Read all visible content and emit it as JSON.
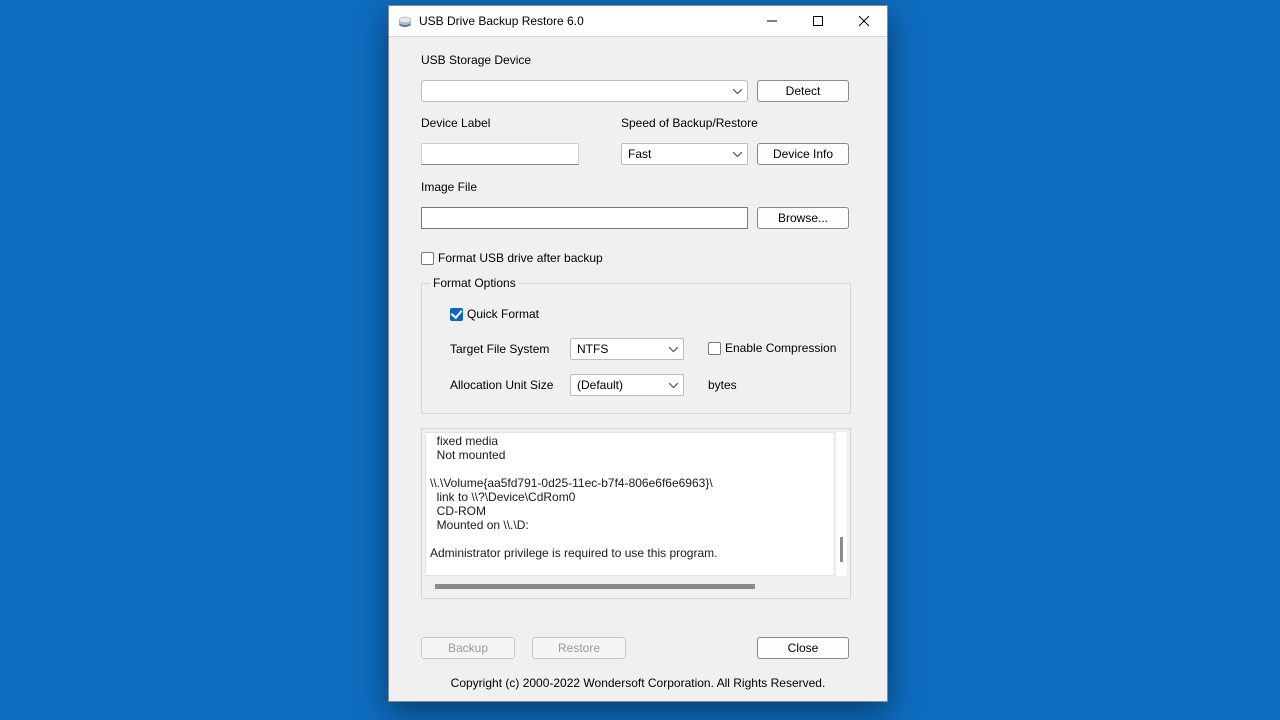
{
  "window": {
    "title": "USB Drive Backup Restore 6.0"
  },
  "labels": {
    "usb_storage_device": "USB Storage Device",
    "device_label": "Device Label",
    "speed": "Speed of Backup/Restore",
    "image_file": "Image File",
    "format_after_backup": "Format USB drive after backup",
    "format_options": "Format Options",
    "quick_format": "Quick Format",
    "target_fs": "Target File System",
    "enable_compression": "Enable Compression",
    "alloc_unit_size": "Allocation Unit Size",
    "bytes": "bytes"
  },
  "buttons": {
    "detect": "Detect",
    "device_info": "Device Info",
    "browse": "Browse...",
    "backup": "Backup",
    "restore": "Restore",
    "close": "Close"
  },
  "fields": {
    "usb_device_selected": "",
    "device_label_value": "",
    "speed_selected": "Fast",
    "image_file_value": "",
    "target_fs_selected": "NTFS",
    "alloc_unit_selected": "(Default)"
  },
  "checkboxes": {
    "format_after_backup": false,
    "quick_format": true,
    "enable_compression": false
  },
  "log_text": "  fixed media\n  Not mounted\n\n\\\\.\\Volume{aa5fd791-0d25-11ec-b7f4-806e6f6e6963}\\\n  link to \\\\?\\Device\\CdRom0\n  CD-ROM\n  Mounted on \\\\.\\D:\n\nAdministrator privilege is required to use this program.\n",
  "footer": {
    "copyright": "Copyright (c) 2000-2022 Wondersoft Corporation. All Rights Reserved."
  }
}
